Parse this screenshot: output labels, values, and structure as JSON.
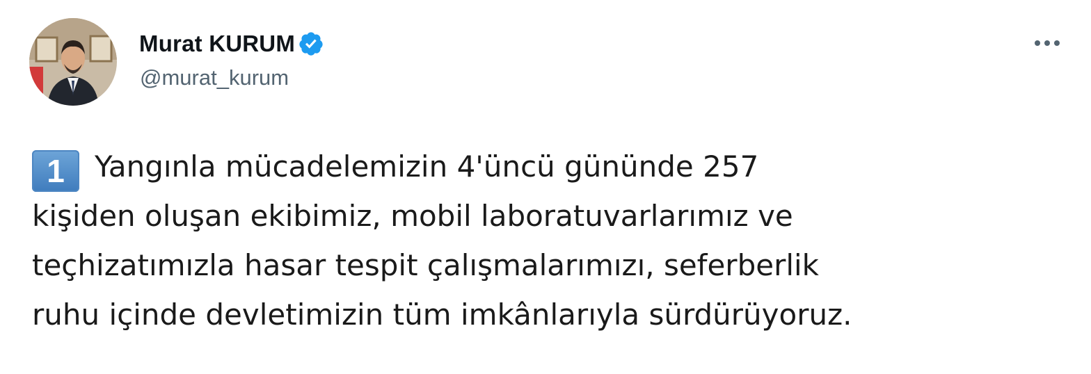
{
  "tweet": {
    "display_name": "Murat KURUM",
    "handle": "@murat_kurum",
    "verified_icon": "verified-badge-icon",
    "more_icon": "more-options-icon",
    "accent_color": "#1d9bf0",
    "keycap_label": "1",
    "lines": [
      "Yangınla mücadelemizin 4'üncü gününde 257",
      "kişiden oluşan ekibimiz, mobil laboratuvarlarımız ve",
      "teçhizatımızla hasar tespit çalışmalarımızı, seferberlik",
      "ruhu içinde devletimizin tüm imkânlarıyla sürdürüyoruz."
    ]
  }
}
